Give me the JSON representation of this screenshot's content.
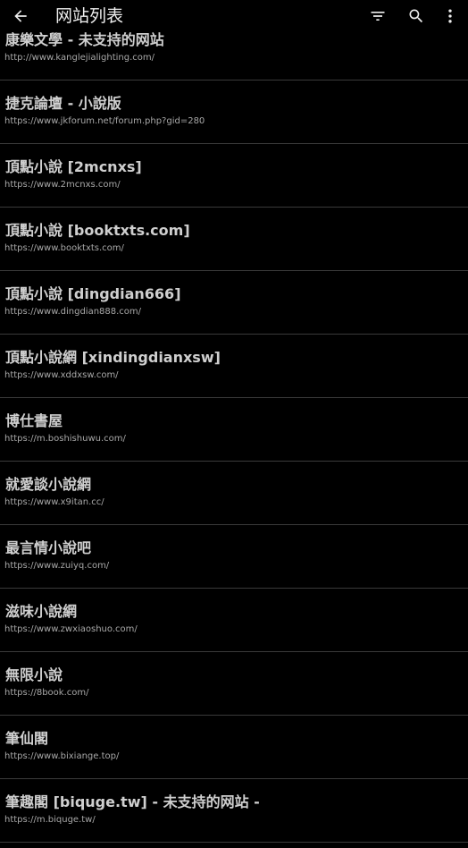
{
  "toolbar": {
    "title": "网站列表",
    "back_icon": "arrow-left-icon",
    "filter_icon": "filter-icon",
    "search_icon": "search-icon",
    "more_icon": "more-vertical-icon"
  },
  "colors": {
    "background": "#000000",
    "divider": "#3a3a3a",
    "title_text": "#eeeeee",
    "name_text": "#cfcfcf",
    "url_text": "#a8a8a8"
  },
  "sites": [
    {
      "name": "康樂文學 - 未支持的网站",
      "url": "http://www.kanglejialighting.com/"
    },
    {
      "name": "捷克論壇 - 小說版",
      "url": "https://www.jkforum.net/forum.php?gid=280"
    },
    {
      "name": "頂點小說 [2mcnxs]",
      "url": "https://www.2mcnxs.com/"
    },
    {
      "name": "頂點小說 [booktxts.com]",
      "url": "https://www.booktxts.com/"
    },
    {
      "name": "頂點小說 [dingdian666]",
      "url": "https://www.dingdian888.com/"
    },
    {
      "name": "頂點小說網 [xindingdianxsw]",
      "url": "https://www.xddxsw.com/"
    },
    {
      "name": "博仕書屋",
      "url": "https://m.boshishuwu.com/"
    },
    {
      "name": "就愛談小說網",
      "url": "https://www.x9itan.cc/"
    },
    {
      "name": "最言情小說吧",
      "url": "https://www.zuiyq.com/"
    },
    {
      "name": "滋味小說網",
      "url": "https://www.zwxiaoshuo.com/"
    },
    {
      "name": "無限小說",
      "url": "https://8book.com/"
    },
    {
      "name": "筆仙閣",
      "url": "https://www.bixiange.top/"
    },
    {
      "name": "筆趣閣 [biquge.tw] - 未支持的网站 -",
      "url": "https://m.biquge.tw/"
    }
  ]
}
